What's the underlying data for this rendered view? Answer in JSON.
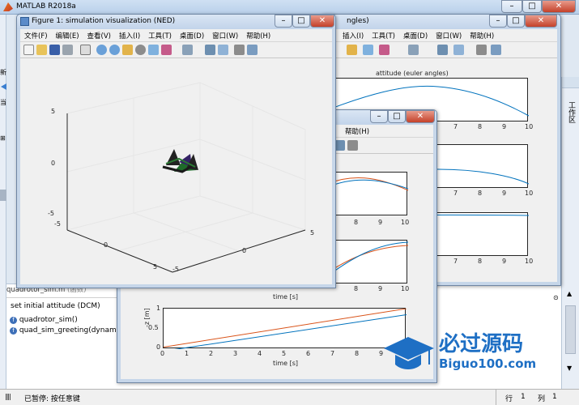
{
  "app": {
    "title": "MATLAB R2018a",
    "window_buttons": {
      "minimize": "–",
      "maximize": "□",
      "close": "✕"
    }
  },
  "left_panel": {
    "label1": "当",
    "label2": "新"
  },
  "right_panel": {
    "label": "工作区"
  },
  "editor": {
    "file_tab": "quadrotor_sim.m",
    "file_tab_suffix": "(函数)",
    "items": [
      {
        "text": "set initial attitude (DCM)"
      },
      {
        "text": "quadrotor_sim()"
      },
      {
        "text": "quad_sim_greeting(dynamics,"
      }
    ]
  },
  "status": {
    "text": "已暂停: 按任意键",
    "row_label": "行",
    "row_value": "1",
    "col_label": "列",
    "col_value": "1"
  },
  "fig1": {
    "title": "Figure 1: simulation visualization (NED)",
    "menu": [
      "文件(F)",
      "编辑(E)",
      "查看(V)",
      "插入(I)",
      "工具(T)",
      "桌面(D)",
      "窗口(W)",
      "帮助(H)"
    ],
    "zticks": [
      "5",
      "0",
      "-5"
    ],
    "yticks": [
      "-5",
      "0",
      "5"
    ],
    "xticks": [
      "5",
      "0",
      "-5"
    ]
  },
  "fig2": {
    "title_suffix": "ngles)",
    "menu": [
      "插入(I)",
      "工具(T)",
      "桌面(D)",
      "窗口(W)",
      "帮助(H)"
    ],
    "subplot_title": "attitude (euler angles)",
    "xticks": [
      "7",
      "8",
      "9",
      "10"
    ]
  },
  "fig3": {
    "menu": [
      "帮助(H)"
    ],
    "xticks_top": [
      "8",
      "9",
      "10"
    ],
    "xlabel": "time [s]",
    "bottom_ylabel": "-z [m]",
    "bottom_yticks": [
      "1",
      "0.5",
      "0"
    ],
    "bottom_xticks": [
      "0",
      "1",
      "2",
      "3",
      "4",
      "5",
      "6",
      "7",
      "8",
      "9",
      "10"
    ]
  },
  "watermark": {
    "cn": "必过源码",
    "en": "Biguo100.com"
  },
  "colors": {
    "series_blue": "#0072bd",
    "series_orange": "#d95319",
    "titlebar": "#c2d4ea",
    "watermark_blue": "#1e6fc4"
  }
}
